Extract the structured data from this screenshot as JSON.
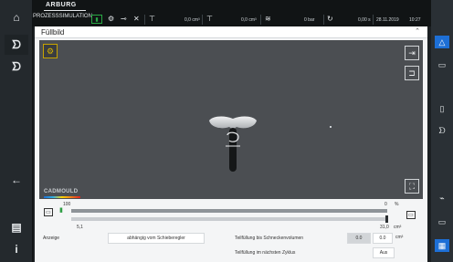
{
  "topbar": {
    "brand": "ARBURG",
    "mode": "PROZESSSIMULATION",
    "status_icon": "traffic-light-icon",
    "val1": "0,0 cm³",
    "val2": "0,0 cm³",
    "val3": "0 bar",
    "val4": "0,00 s",
    "date": "28.11.2019",
    "time": "10:27"
  },
  "leftnav": {
    "items": [
      "home-icon",
      "injection-icon",
      "injection-alt-icon",
      "back-arrow-icon",
      "print-icon",
      "info-icon"
    ],
    "info_label": "i"
  },
  "panel": {
    "title": "Füllbild",
    "collapse": "⌃"
  },
  "viewport": {
    "logo": "CADMOULD",
    "badge_icon": "mould-icon",
    "rbtn1_icon": "export-icon",
    "rbtn2_icon": "layout-icon",
    "fit_icon": "fit-view-icon"
  },
  "slider": {
    "top_left_value": "100",
    "top_right_value": "0",
    "top_right_unit": "%",
    "bottom_left_value": "5,1",
    "bottom_right_value": "31,0",
    "bottom_right_unit": "cm³",
    "position_percent": 0
  },
  "form": {
    "anzeige_label": "Anzeige",
    "anzeige_value": "abhängig vom Schieberegler",
    "teilfuellung_label": "Teilfüllung bis Schneckenvolumen",
    "teilfuellung_readonly": "0.0",
    "teilfuellung_value": "0.0",
    "teilfuellung_unit": "cm³",
    "naechster_label": "Teilfüllung im nächsten Zyklus",
    "naechster_value": "Aus"
  },
  "colors": {
    "accent_blue": "#1d6fd6",
    "status_green": "#28a844",
    "badge_yellow": "#c6a300"
  }
}
